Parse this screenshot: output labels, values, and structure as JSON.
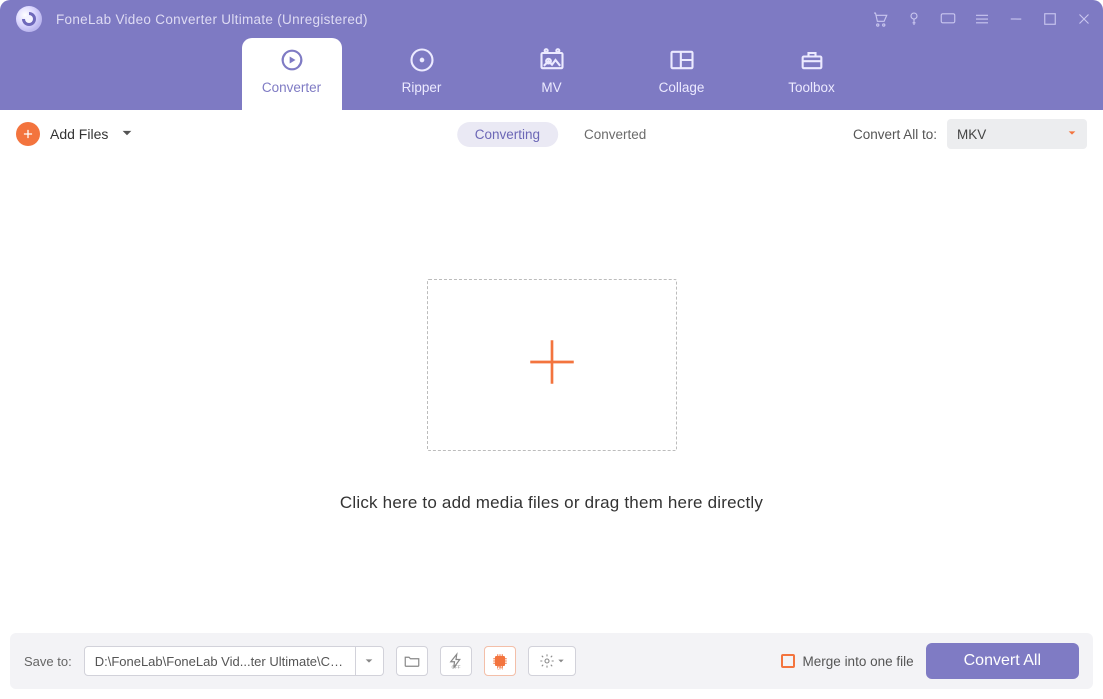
{
  "title": "FoneLab Video Converter Ultimate (Unregistered)",
  "nav": {
    "converter": "Converter",
    "ripper": "Ripper",
    "mv": "MV",
    "collage": "Collage",
    "toolbox": "Toolbox"
  },
  "toolbar": {
    "add_files": "Add Files",
    "converting_tab": "Converting",
    "converted_tab": "Converted",
    "convert_all_to": "Convert All to:",
    "format_value": "MKV"
  },
  "drop_hint": "Click here to add media files or drag them here directly",
  "bottom": {
    "save_to_label": "Save to:",
    "save_path": "D:\\FoneLab\\FoneLab Vid...ter Ultimate\\Converted",
    "merge_label": "Merge into one file",
    "convert_all_btn": "Convert All"
  },
  "icons": {
    "buy": "cart-icon",
    "register": "key-icon",
    "feedback": "speech-icon",
    "menu": "menu-icon",
    "minimize": "minimize-icon",
    "maximize": "maximize-icon",
    "close": "close-icon"
  }
}
